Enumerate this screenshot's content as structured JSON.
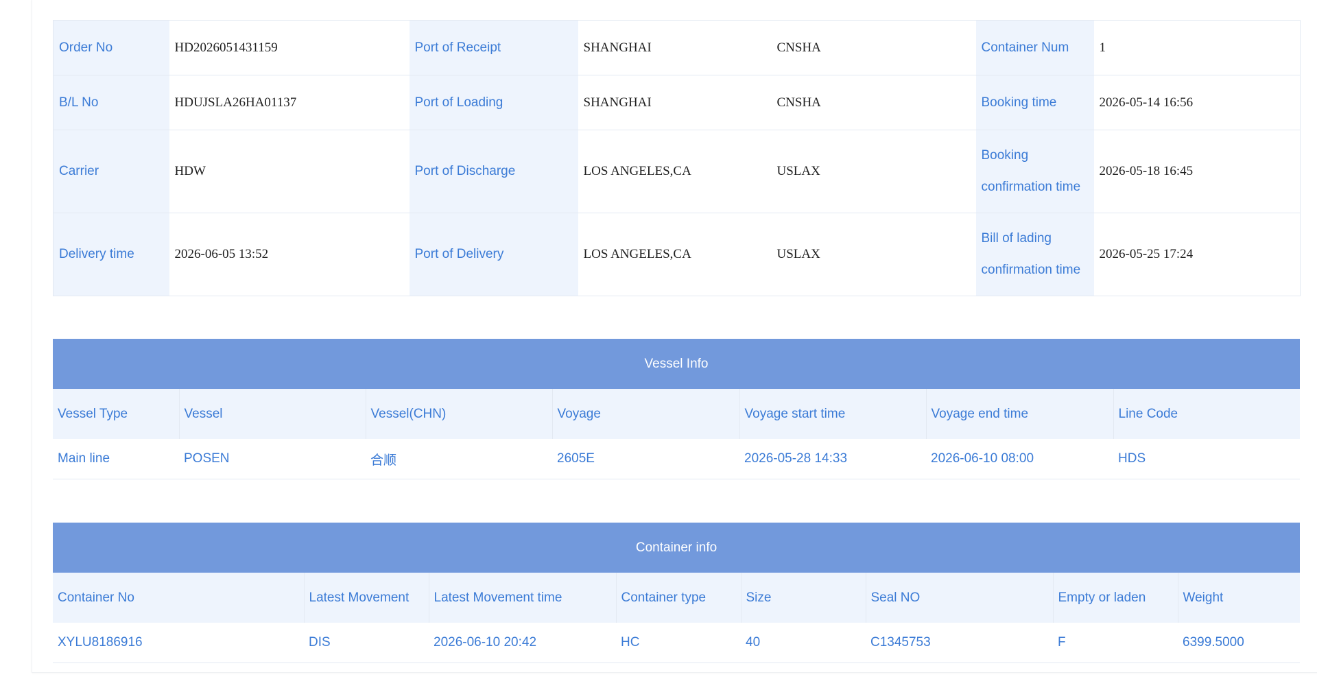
{
  "summary": {
    "rows": [
      {
        "label1": "Order No",
        "value1": "HD2026051431159",
        "label2": "Port of Receipt",
        "port": "SHANGHAI",
        "code": "CNSHA",
        "label3": "Container Num",
        "value3": "1"
      },
      {
        "label1": "B/L No",
        "value1": "HDUJSLA26HA01137",
        "label2": "Port of Loading",
        "port": "SHANGHAI",
        "code": "CNSHA",
        "label3": "Booking time",
        "value3": "2026-05-14 16:56"
      },
      {
        "label1": "Carrier",
        "value1": "HDW",
        "label2": "Port of Discharge",
        "port": "LOS ANGELES,CA",
        "code": "USLAX",
        "label3a": "Booking",
        "label3b": "confirmation time",
        "value3": "2026-05-18 16:45"
      },
      {
        "label1": "Delivery time",
        "value1": "2026-06-05 13:52",
        "label2": "Port of Delivery",
        "port": "LOS ANGELES,CA",
        "code": "USLAX",
        "label3a": "Bill of lading",
        "label3b": "confirmation time",
        "value3": "2026-05-25 17:24"
      }
    ]
  },
  "vessel": {
    "title": "Vessel Info",
    "headers": [
      "Vessel Type",
      "Vessel",
      "Vessel(CHN)",
      "Voyage",
      "Voyage start time",
      "Voyage end time",
      "Line Code"
    ],
    "rows": [
      [
        "Main line",
        "POSEN",
        "合顺",
        "2605E",
        "2026-05-28 14:33",
        "2026-06-10 08:00",
        "HDS"
      ]
    ]
  },
  "container": {
    "title": "Container info",
    "headers": [
      "Container No",
      "Latest Movement",
      "Latest Movement time",
      "Container type",
      "Size",
      "Seal NO",
      "Empty or laden",
      "Weight"
    ],
    "rows": [
      [
        "XYLU8186916",
        "DIS",
        "2026-06-10 20:42",
        "HC",
        "40",
        "C1345753",
        "F",
        "6399.5000"
      ]
    ]
  },
  "colors": {
    "banner": "#7299dc",
    "label_bg": "#eef4fd",
    "label_text": "#3b7bd6",
    "value_text": "#1f1f1f"
  }
}
